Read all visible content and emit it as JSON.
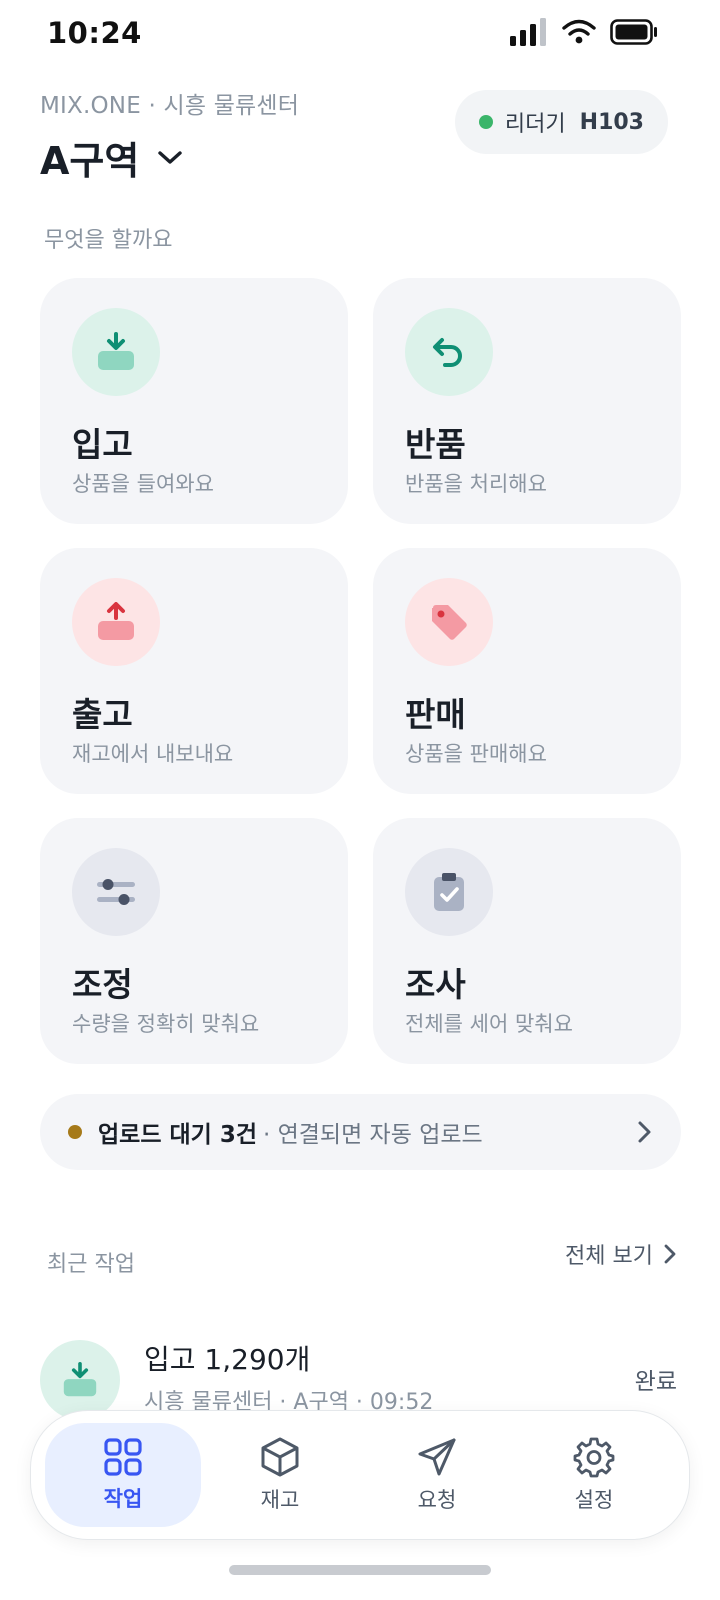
{
  "status_bar": {
    "time": "10:24"
  },
  "header": {
    "org": "MIX.ONE · 시흥 물류센터",
    "zone": "A구역",
    "reader_label": "리더기",
    "reader_id": "H103",
    "reader_status_color": "#3bb56a"
  },
  "section_title": "무엇을 할까요",
  "actions": [
    {
      "title": "입고",
      "subtitle": "상품을 들여와요",
      "icon": "inbound-tray-icon",
      "tone": "green"
    },
    {
      "title": "반품",
      "subtitle": "반품을 처리해요",
      "icon": "return-arrow-icon",
      "tone": "green"
    },
    {
      "title": "출고",
      "subtitle": "재고에서 내보내요",
      "icon": "outbound-tray-icon",
      "tone": "red"
    },
    {
      "title": "판매",
      "subtitle": "상품을 판매해요",
      "icon": "price-tag-icon",
      "tone": "red"
    },
    {
      "title": "조정",
      "subtitle": "수량을 정확히 맞춰요",
      "icon": "sliders-icon",
      "tone": "gray"
    },
    {
      "title": "조사",
      "subtitle": "전체를 세어 맞춰요",
      "icon": "clipboard-check-icon",
      "tone": "gray"
    }
  ],
  "upload_banner": {
    "strong": "업로드 대기 3건",
    "rest": "· 연결되면 자동 업로드",
    "dot_color": "#a67a1a"
  },
  "recent": {
    "title": "최근 작업",
    "see_all": "전체 보기",
    "items": [
      {
        "title": "입고 1,290개",
        "meta": "시흥 물류센터 · A구역 · 09:52",
        "status": "완료",
        "icon": "inbound-tray-icon"
      }
    ]
  },
  "tabs": [
    {
      "label": "작업",
      "icon": "grid-icon",
      "active": true
    },
    {
      "label": "재고",
      "icon": "box-icon",
      "active": false
    },
    {
      "label": "요청",
      "icon": "send-icon",
      "active": false
    },
    {
      "label": "설정",
      "icon": "gear-icon",
      "active": false
    }
  ],
  "colors": {
    "accent": "#3856f2",
    "teal": "#1a9a80",
    "red": "#e03b4c"
  }
}
